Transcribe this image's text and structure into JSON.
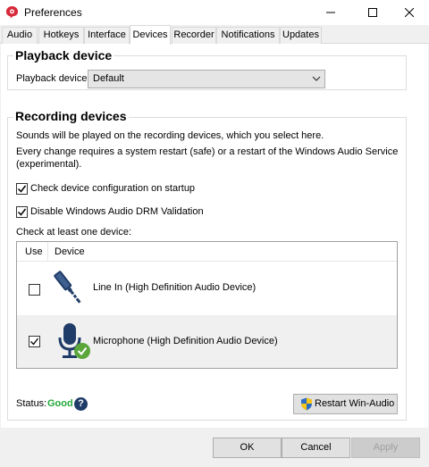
{
  "window": {
    "title": "Preferences"
  },
  "tabs": [
    "Audio",
    "Hotkeys",
    "Interface",
    "Devices",
    "Recorder",
    "Notifications",
    "Updates"
  ],
  "active_tab": "Devices",
  "playback": {
    "title": "Playback device",
    "label": "Playback device:",
    "selected": "Default"
  },
  "recording": {
    "title": "Recording devices",
    "info1": "Sounds will be played on the recording devices, which you select here.",
    "info2a": "Every change requires a system restart (safe) or a restart of the Windows Audio Service",
    "info2b": "(experimental).",
    "check_config": {
      "label": "Check device configuration on startup",
      "checked": true
    },
    "disable_drm": {
      "label": "Disable Windows Audio DRM Validation",
      "checked": true
    },
    "check_one_label": "Check at least one device:",
    "columns": {
      "use": "Use",
      "device": "Device"
    },
    "devices": [
      {
        "name": "Line In (High Definition Audio Device)",
        "checked": false,
        "icon": "line-in-jack-icon"
      },
      {
        "name": "Microphone (High Definition Audio Device)",
        "checked": true,
        "icon": "microphone-icon"
      }
    ],
    "status_label": "Status:",
    "status_value": "Good",
    "restart_button": "Restart Win-Audio"
  },
  "footer": {
    "ok": "OK",
    "cancel": "Cancel",
    "apply": "Apply"
  },
  "colors": {
    "good": "#22a83a",
    "icon_blue": "#1f3b68",
    "check_green": "#5aa63a"
  }
}
